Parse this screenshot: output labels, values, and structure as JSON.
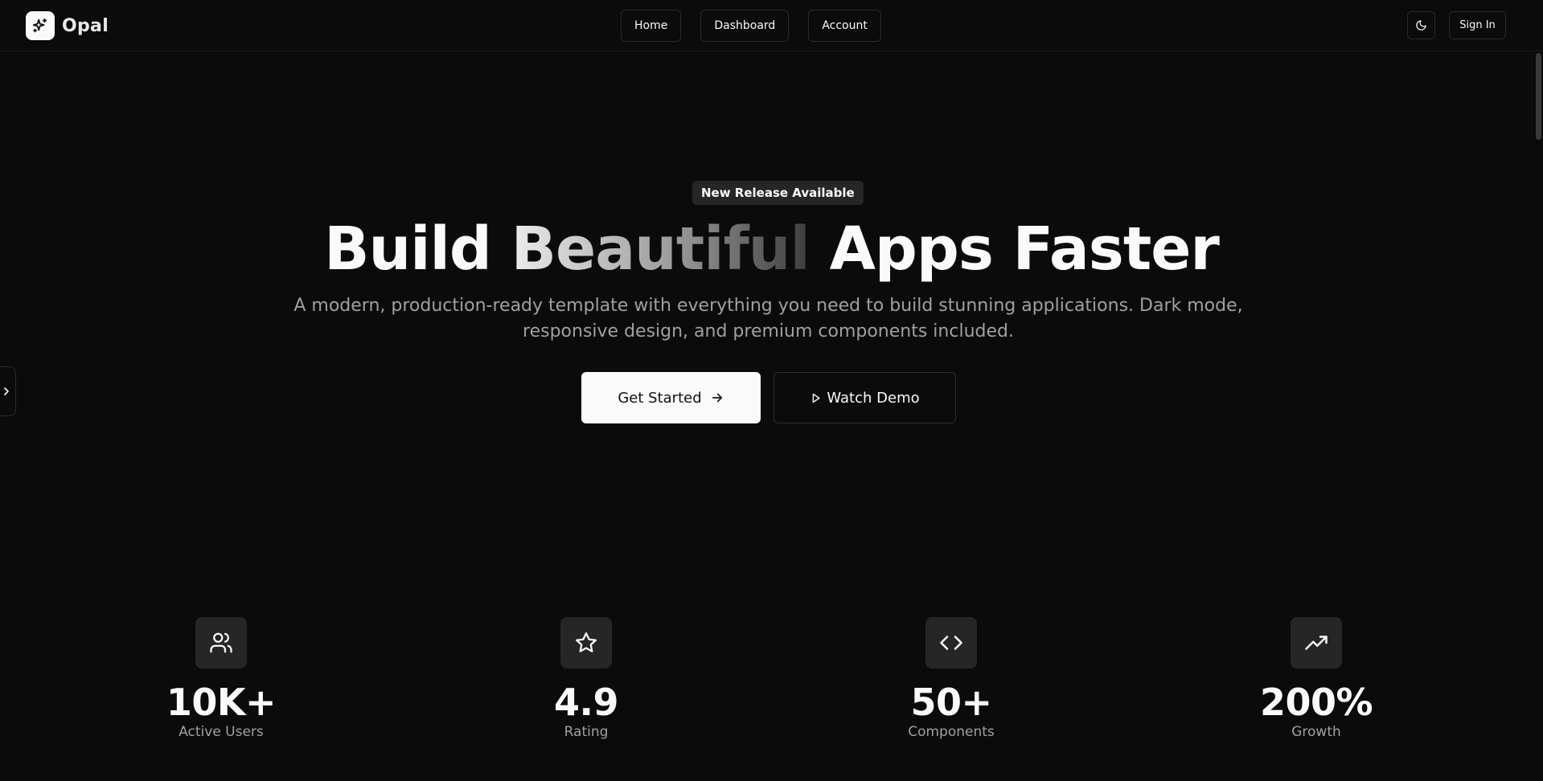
{
  "header": {
    "brand": "Opal",
    "nav": [
      "Home",
      "Dashboard",
      "Account"
    ],
    "theme_icon": "moon-icon",
    "signin_label": "Sign In"
  },
  "hero": {
    "badge": "New Release Available",
    "title_before": "Build ",
    "title_highlight": "Beautiful",
    "title_after": " Apps Faster",
    "subtitle": "A modern, production-ready template with everything you need to build stunning applications. Dark mode, responsive design, and premium components included.",
    "primary_cta": "Get Started",
    "secondary_cta": "Watch Demo"
  },
  "stats": [
    {
      "icon": "users-icon",
      "value": "10K+",
      "label": "Active Users"
    },
    {
      "icon": "star-icon",
      "value": "4.9",
      "label": "Rating"
    },
    {
      "icon": "code-icon",
      "value": "50+",
      "label": "Components"
    },
    {
      "icon": "trending-up-icon",
      "value": "200%",
      "label": "Growth"
    }
  ],
  "colors": {
    "background": "#0b0b0b",
    "foreground": "#fafafa",
    "muted": "#a0a0a0",
    "border": "#2a2a2a",
    "badge_bg": "#262626"
  }
}
